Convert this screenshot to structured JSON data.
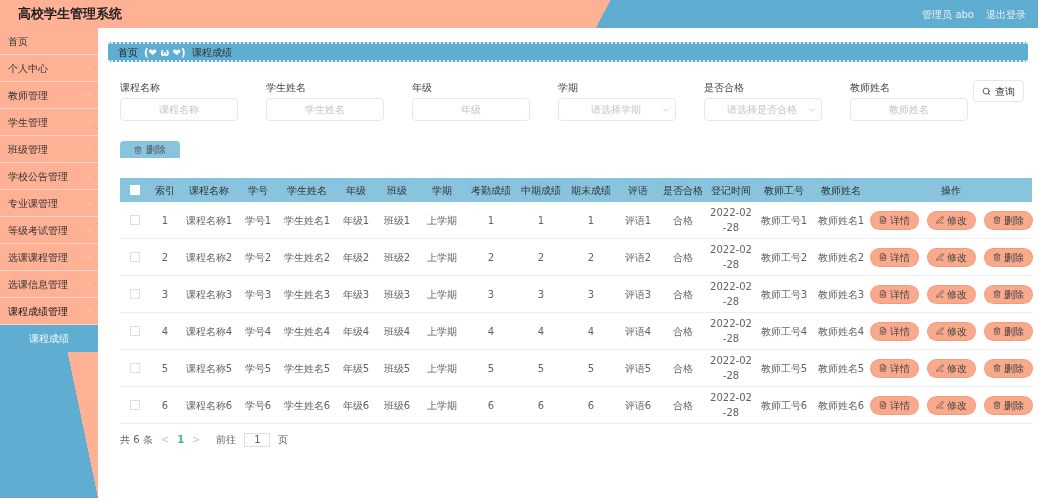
{
  "header": {
    "title": "高校学生管理系统",
    "user": "管理员 abo",
    "logout": "退出登录"
  },
  "sidebar": {
    "items": [
      {
        "label": "首页",
        "expandable": false,
        "expanded": false
      },
      {
        "label": "个人中心",
        "expandable": true,
        "expanded": false
      },
      {
        "label": "教师管理",
        "expandable": true,
        "expanded": false
      },
      {
        "label": "学生管理",
        "expandable": true,
        "expanded": false
      },
      {
        "label": "班级管理",
        "expandable": true,
        "expanded": false
      },
      {
        "label": "学校公告管理",
        "expandable": true,
        "expanded": false
      },
      {
        "label": "专业课管理",
        "expandable": true,
        "expanded": false
      },
      {
        "label": "等级考试管理",
        "expandable": true,
        "expanded": false
      },
      {
        "label": "选课课程管理",
        "expandable": true,
        "expanded": false
      },
      {
        "label": "选课信息管理",
        "expandable": true,
        "expanded": false
      },
      {
        "label": "课程成绩管理",
        "expandable": true,
        "expanded": true,
        "children": [
          {
            "label": "课程成绩",
            "selected": true
          }
        ]
      }
    ]
  },
  "breadcrumb": {
    "items": [
      "首页",
      "(❤ ω ❤)",
      "课程成绩"
    ]
  },
  "filters": [
    {
      "kind": "input",
      "label": "课程名称",
      "placeholder": "课程名称"
    },
    {
      "kind": "input",
      "label": "学生姓名",
      "placeholder": "学生姓名"
    },
    {
      "kind": "input",
      "label": "年级",
      "placeholder": "年级"
    },
    {
      "kind": "select",
      "label": "学期",
      "placeholder": "请选择学期"
    },
    {
      "kind": "select",
      "label": "是否合格",
      "placeholder": "请选择是否合格"
    },
    {
      "kind": "input",
      "label": "教师姓名",
      "placeholder": "教师姓名"
    }
  ],
  "search_button": "查询",
  "delete_button": "删除",
  "table": {
    "select_all": {
      "checked": false
    },
    "columns": [
      "索引",
      "课程名称",
      "学号",
      "学生姓名",
      "年级",
      "班级",
      "学期",
      "考勤成绩",
      "中期成绩",
      "期末成绩",
      "评语",
      "是否合格",
      "登记时间",
      "教师工号",
      "教师姓名",
      "操作"
    ],
    "rows": [
      {
        "checked": false,
        "cells": [
          "1",
          "课程名称1",
          "学号1",
          "学生姓名1",
          "年级1",
          "班级1",
          "上学期",
          "1",
          "1",
          "1",
          "评语1",
          "合格",
          "2022-02-28",
          "教师工号1",
          "教师姓名1"
        ],
        "actions": [
          "详情",
          "修改",
          "删除"
        ]
      },
      {
        "checked": false,
        "cells": [
          "2",
          "课程名称2",
          "学号2",
          "学生姓名2",
          "年级2",
          "班级2",
          "上学期",
          "2",
          "2",
          "2",
          "评语2",
          "合格",
          "2022-02-28",
          "教师工号2",
          "教师姓名2"
        ],
        "actions": [
          "详情",
          "修改",
          "删除"
        ]
      },
      {
        "checked": false,
        "cells": [
          "3",
          "课程名称3",
          "学号3",
          "学生姓名3",
          "年级3",
          "班级3",
          "上学期",
          "3",
          "3",
          "3",
          "评语3",
          "合格",
          "2022-02-28",
          "教师工号3",
          "教师姓名3"
        ],
        "actions": [
          "详情",
          "修改",
          "删除"
        ]
      },
      {
        "checked": false,
        "cells": [
          "4",
          "课程名称4",
          "学号4",
          "学生姓名4",
          "年级4",
          "班级4",
          "上学期",
          "4",
          "4",
          "4",
          "评语4",
          "合格",
          "2022-02-28",
          "教师工号4",
          "教师姓名4"
        ],
        "actions": [
          "详情",
          "修改",
          "删除"
        ]
      },
      {
        "checked": false,
        "cells": [
          "5",
          "课程名称5",
          "学号5",
          "学生姓名5",
          "年级5",
          "班级5",
          "上学期",
          "5",
          "5",
          "5",
          "评语5",
          "合格",
          "2022-02-28",
          "教师工号5",
          "教师姓名5"
        ],
        "actions": [
          "详情",
          "修改",
          "删除"
        ]
      },
      {
        "checked": false,
        "cells": [
          "6",
          "课程名称6",
          "学号6",
          "学生姓名6",
          "年级6",
          "班级6",
          "上学期",
          "6",
          "6",
          "6",
          "评语6",
          "合格",
          "2022-02-28",
          "教师工号6",
          "教师姓名6"
        ],
        "actions": [
          "详情",
          "修改",
          "删除"
        ]
      }
    ]
  },
  "pagination": {
    "total": "共 6 条",
    "prev": "<",
    "pages": [
      {
        "label": "1",
        "selected": true
      }
    ],
    "next": ">",
    "goto": "前往",
    "page_input": "1",
    "page_unit": "页"
  }
}
